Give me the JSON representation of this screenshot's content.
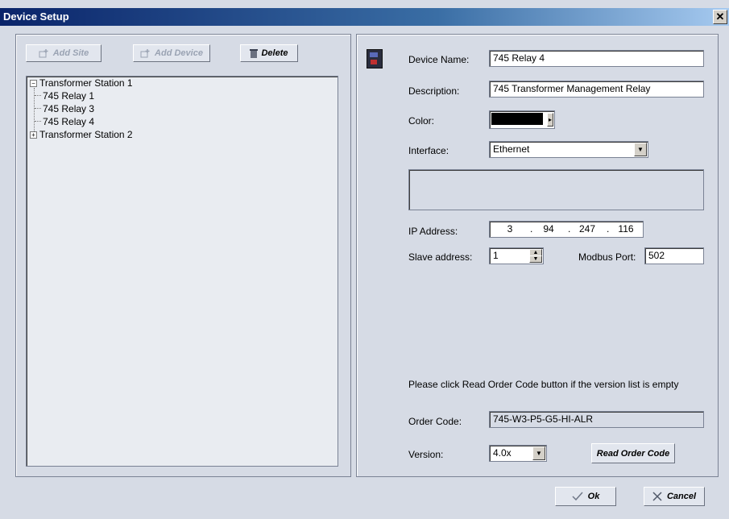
{
  "window": {
    "title": "Device Setup",
    "close_glyph": "✕"
  },
  "toolbar": {
    "add_site": "Add Site",
    "add_device": "Add Device",
    "delete": "Delete"
  },
  "tree": {
    "sites": [
      {
        "label": "Transformer Station 1",
        "expanded": true,
        "children": [
          "745 Relay 1",
          "745 Relay 3",
          "745 Relay 4"
        ]
      },
      {
        "label": "Transformer Station 2",
        "expanded": false,
        "children": []
      }
    ]
  },
  "form": {
    "device_name_label": "Device Name:",
    "device_name_value": "745 Relay 4",
    "description_label": "Description:",
    "description_value": "745 Transformer Management Relay",
    "color_label": "Color:",
    "color_value": "#000000",
    "interface_label": "Interface:",
    "interface_value": "Ethernet",
    "ip_label": "IP Address:",
    "ip": [
      "3",
      "94",
      "247",
      "116"
    ],
    "slave_label": "Slave address:",
    "slave_value": "1",
    "modbus_label": "Modbus Port:",
    "modbus_value": "502",
    "hint": "Please click Read Order Code button if the version list is empty",
    "order_code_label": "Order Code:",
    "order_code_value": "745-W3-P5-G5-HI-ALR",
    "version_label": "Version:",
    "version_value": "4.0x",
    "read_order_code": "Read Order Code"
  },
  "footer": {
    "ok": "Ok",
    "cancel": "Cancel"
  }
}
